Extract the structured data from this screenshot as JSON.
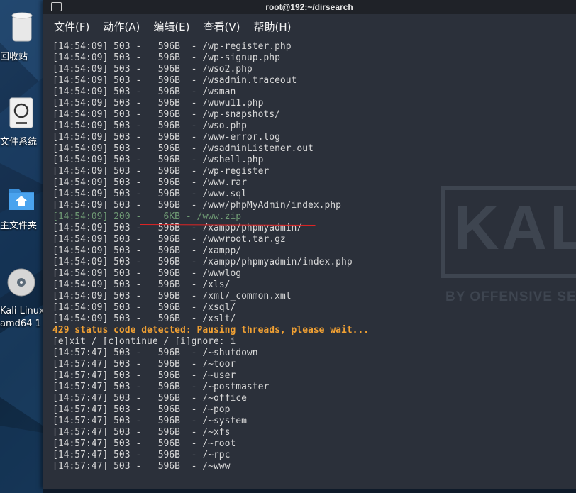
{
  "window": {
    "title": "root@192:~/dirsearch"
  },
  "menu": [
    "文件(F)",
    "动作(A)",
    "编辑(E)",
    "查看(V)",
    "帮助(H)"
  ],
  "desktop_icons": [
    {
      "label": "回收站",
      "icon": "trash-icon"
    },
    {
      "label": "文件系统",
      "icon": "filesystem-icon"
    },
    {
      "label": "主文件夹",
      "icon": "home-folder-icon"
    },
    {
      "label": "Kali Linux",
      "label2": "amd64 1",
      "icon": "disc-icon"
    }
  ],
  "watermark": {
    "brand": "KALI",
    "tagline": "BY OFFENSIVE SECURI"
  },
  "terminal_lines": [
    {
      "text": "[14:54:09] 503 -   596B  - /wp-register.php",
      "kind": "normal"
    },
    {
      "text": "[14:54:09] 503 -   596B  - /wp-signup.php",
      "kind": "normal"
    },
    {
      "text": "[14:54:09] 503 -   596B  - /wso2.php",
      "kind": "normal"
    },
    {
      "text": "[14:54:09] 503 -   596B  - /wsadmin.traceout",
      "kind": "normal"
    },
    {
      "text": "[14:54:09] 503 -   596B  - /wsman",
      "kind": "normal"
    },
    {
      "text": "[14:54:09] 503 -   596B  - /wuwu11.php",
      "kind": "normal"
    },
    {
      "text": "[14:54:09] 503 -   596B  - /wp-snapshots/",
      "kind": "normal"
    },
    {
      "text": "[14:54:09] 503 -   596B  - /wso.php",
      "kind": "normal"
    },
    {
      "text": "[14:54:09] 503 -   596B  - /www-error.log",
      "kind": "normal"
    },
    {
      "text": "[14:54:09] 503 -   596B  - /wsadminListener.out",
      "kind": "normal"
    },
    {
      "text": "[14:54:09] 503 -   596B  - /wshell.php",
      "kind": "normal"
    },
    {
      "text": "[14:54:09] 503 -   596B  - /wp-register",
      "kind": "normal"
    },
    {
      "text": "[14:54:09] 503 -   596B  - /www.rar",
      "kind": "normal"
    },
    {
      "text": "[14:54:09] 503 -   596B  - /www.sql",
      "kind": "normal"
    },
    {
      "text": "[14:54:09] 503 -   596B  - /www/phpMyAdmin/index.php",
      "kind": "normal"
    },
    {
      "text": "[14:54:09] 200 -    6KB - /www.zip",
      "kind": "hit"
    },
    {
      "text": "[14:54:09] 503 -   596B  - /xampp/phpmyadmin/",
      "kind": "normal"
    },
    {
      "text": "[14:54:09] 503 -   596B  - /wwwroot.tar.gz",
      "kind": "normal"
    },
    {
      "text": "[14:54:09] 503 -   596B  - /xampp/",
      "kind": "normal"
    },
    {
      "text": "[14:54:09] 503 -   596B  - /xampp/phpmyadmin/index.php",
      "kind": "normal"
    },
    {
      "text": "[14:54:09] 503 -   596B  - /wwwlog",
      "kind": "normal"
    },
    {
      "text": "[14:54:09] 503 -   596B  - /xls/",
      "kind": "normal"
    },
    {
      "text": "[14:54:09] 503 -   596B  - /xml/_common.xml",
      "kind": "normal"
    },
    {
      "text": "[14:54:09] 503 -   596B  - /xsql/",
      "kind": "normal"
    },
    {
      "text": "[14:54:09] 503 -   596B  - /xslt/",
      "kind": "normal"
    },
    {
      "text": "429 status code detected: Pausing threads, please wait...",
      "kind": "warn"
    },
    {
      "text": "[e]xit / [c]ontinue / [i]gnore: i",
      "kind": "normal"
    },
    {
      "text": "[14:57:47] 503 -   596B  - /~shutdown",
      "kind": "normal"
    },
    {
      "text": "[14:57:47] 503 -   596B  - /~toor",
      "kind": "normal"
    },
    {
      "text": "[14:57:47] 503 -   596B  - /~user",
      "kind": "normal"
    },
    {
      "text": "[14:57:47] 503 -   596B  - /~postmaster",
      "kind": "normal"
    },
    {
      "text": "[14:57:47] 503 -   596B  - /~office",
      "kind": "normal"
    },
    {
      "text": "[14:57:47] 503 -   596B  - /~pop",
      "kind": "normal"
    },
    {
      "text": "[14:57:47] 503 -   596B  - /~system",
      "kind": "normal"
    },
    {
      "text": "[14:57:47] 503 -   596B  - /~xfs",
      "kind": "normal"
    },
    {
      "text": "[14:57:47] 503 -   596B  - /~root",
      "kind": "normal"
    },
    {
      "text": "[14:57:47] 503 -   596B  - /~rpc",
      "kind": "normal"
    },
    {
      "text": "[14:57:47] 503 -   596B  - /~www",
      "kind": "normal"
    }
  ],
  "colors": {
    "terminal_bg": "#2b303a",
    "text": "#d8d8d8",
    "hit": "#6f9a74",
    "warning": "#f0a033",
    "annotation": "#e02424"
  }
}
